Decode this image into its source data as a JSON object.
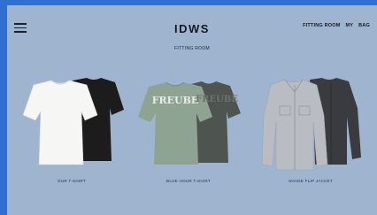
{
  "brand": "IDWS",
  "nav": {
    "fitting_room": "FITTING ROOM",
    "my": "MY",
    "bag": "BAG"
  },
  "subtitle": "FITTING ROOM",
  "products": [
    {
      "name": "OUR T-SHIRT",
      "front_color": "#f6f6f4",
      "back_color": "#1c1c1d"
    },
    {
      "name": "BLUE HOUR T-SHIRT",
      "front_color": "#8fa393",
      "back_color": "#4e5551",
      "print": "FREUBE"
    },
    {
      "name": "SHADE FLIP JACKET",
      "front_color": "#b9bcc2",
      "back_color": "#3a3b3f"
    }
  ],
  "colors": {
    "background": "#9eb4cf",
    "outer_frame": "#2f6fd0",
    "text": "#151922"
  }
}
